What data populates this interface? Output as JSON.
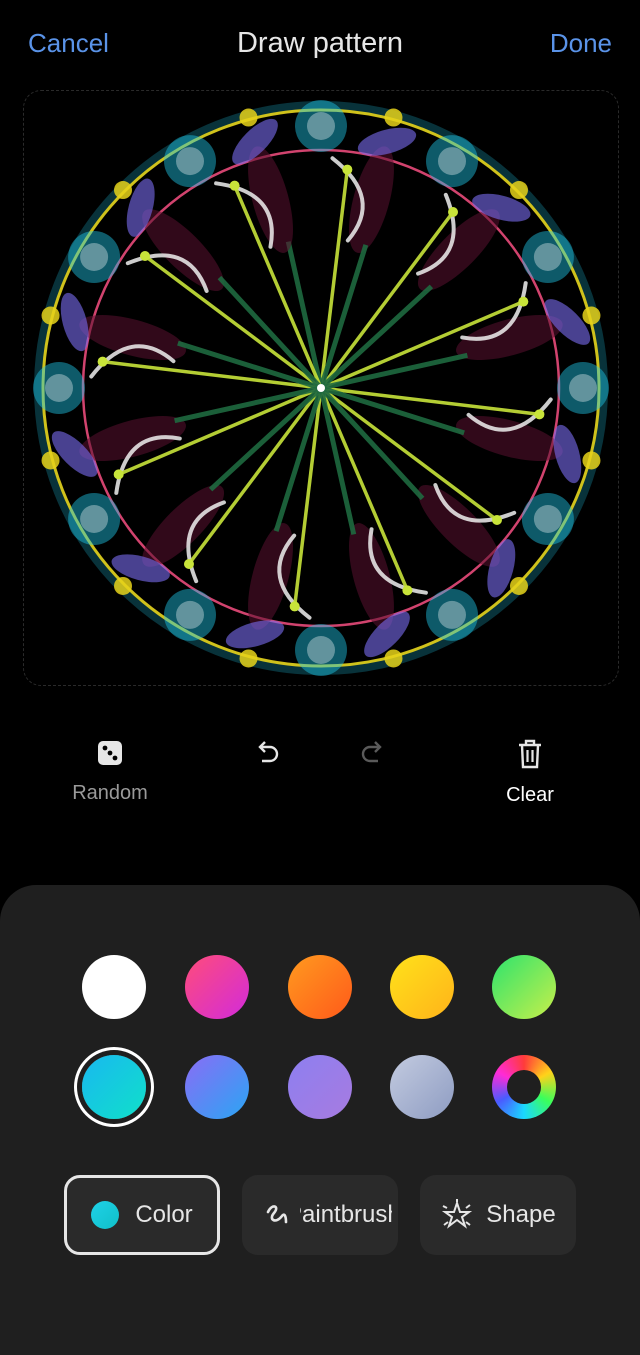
{
  "header": {
    "cancel": "Cancel",
    "title": "Draw pattern",
    "done": "Done"
  },
  "tools": {
    "random": "Random",
    "clear": "Clear"
  },
  "colors": {
    "swatches": [
      {
        "name": "white",
        "from": "#ffffff",
        "to": "#ffffff"
      },
      {
        "name": "pink",
        "from": "#ff4c7a",
        "to": "#d22bdb"
      },
      {
        "name": "orange",
        "from": "#ff9a1f",
        "to": "#ff5a1a"
      },
      {
        "name": "yellow",
        "from": "#ffe21a",
        "to": "#ffb31a"
      },
      {
        "name": "green",
        "from": "#2de36d",
        "to": "#c8ef4a"
      },
      {
        "name": "cyan",
        "from": "#19b8f0",
        "to": "#10e0c9"
      },
      {
        "name": "blue",
        "from": "#8a6cf5",
        "to": "#2aa6f4"
      },
      {
        "name": "purple",
        "from": "#8d7ff0",
        "to": "#a77be0"
      },
      {
        "name": "grey-blue",
        "from": "#c3cbe0",
        "to": "#8e9cc2"
      },
      {
        "name": "color-wheel",
        "from": "",
        "to": ""
      }
    ],
    "selected": "cyan"
  },
  "tabs": {
    "color": "Color",
    "paintbrush": "Paintbrush",
    "shape": "Shape"
  }
}
